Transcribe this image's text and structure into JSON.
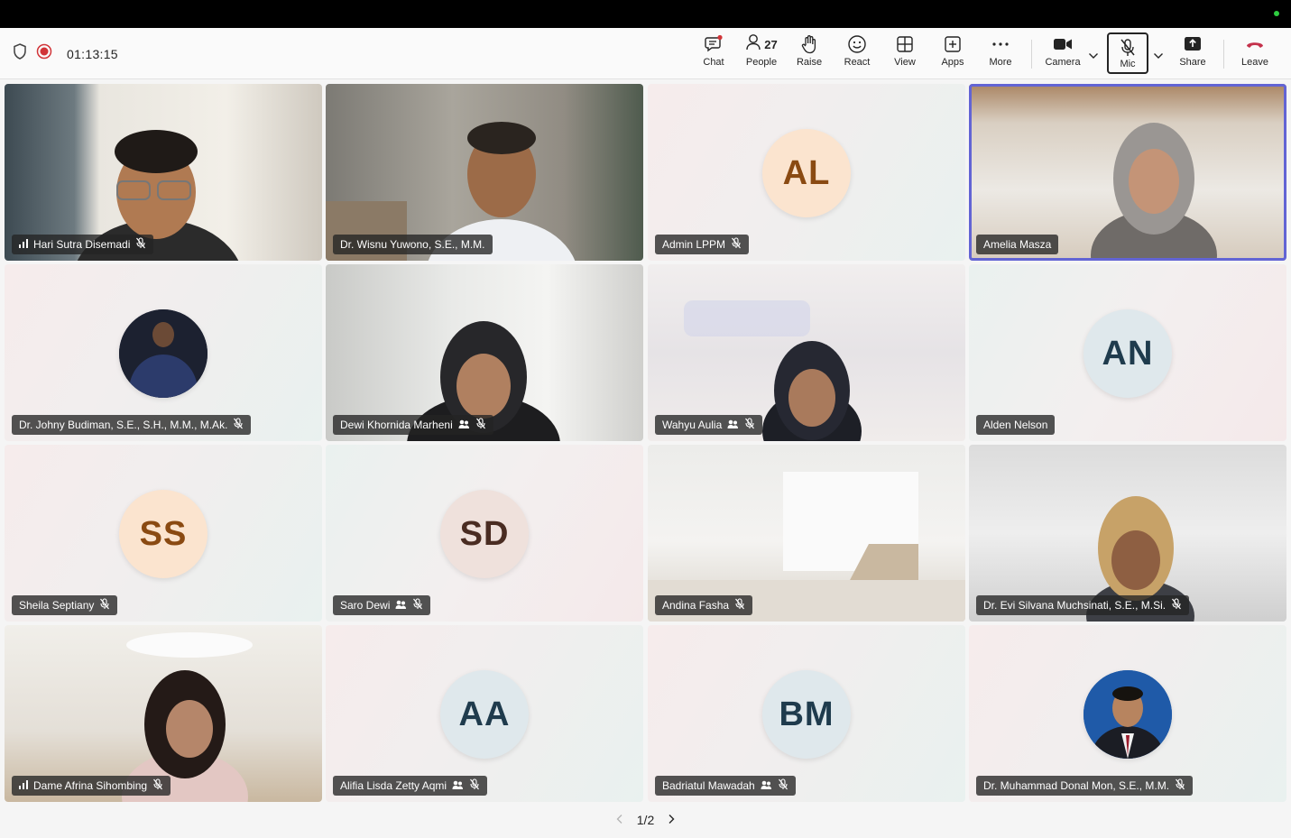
{
  "status": {
    "timer": "01:13:15"
  },
  "toolbar": {
    "chat": "Chat",
    "people": "People",
    "people_count": "27",
    "raise": "Raise",
    "react": "React",
    "view": "View",
    "apps": "Apps",
    "more": "More",
    "camera": "Camera",
    "mic": "Mic",
    "share": "Share",
    "leave": "Leave"
  },
  "participants": [
    {
      "name": "Hari Sutra Disemadi"
    },
    {
      "name": "Dr. Wisnu Yuwono, S.E., M.M."
    },
    {
      "name": "Admin LPPM",
      "initials": "AL"
    },
    {
      "name": "Amelia Masza"
    },
    {
      "name": "Dr. Johny Budiman, S.E., S.H., M.M., M.Ak."
    },
    {
      "name": "Dewi Khornida Marheni"
    },
    {
      "name": "Wahyu Aulia"
    },
    {
      "name": "Alden Nelson",
      "initials": "AN"
    },
    {
      "name": "Sheila Septiany",
      "initials": "SS"
    },
    {
      "name": "Saro Dewi",
      "initials": "SD"
    },
    {
      "name": "Andina Fasha"
    },
    {
      "name": "Dr. Evi Silvana Muchsinati, S.E., M.Si."
    },
    {
      "name": "Dame Afrina Sihombing"
    },
    {
      "name": "Alifia Lisda Zetty Aqmi",
      "initials": "AA"
    },
    {
      "name": "Badriatul Mawadah",
      "initials": "BM"
    },
    {
      "name": "Dr. Muhammad Donal Mon, S.E., M.M."
    }
  ],
  "pager": {
    "label": "1/2"
  },
  "colors": {
    "accent": "#6264d4",
    "leave": "#c4314b",
    "record": "#d13438"
  }
}
